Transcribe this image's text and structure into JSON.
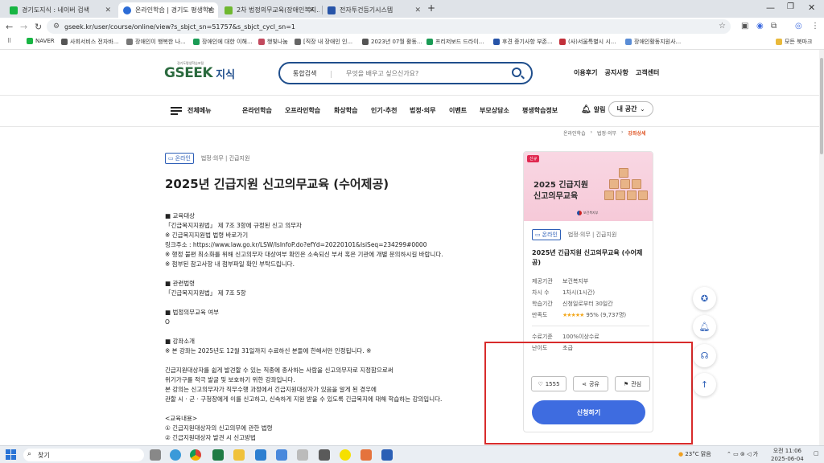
{
  "browser": {
    "tabs": [
      {
        "title": "경기도지식 : 네이버 검색",
        "color": "#18b543"
      },
      {
        "title": "온라인학습 | 경기도 평생학습",
        "color": "#2c6cd6"
      },
      {
        "title": "2차 법정의무교육(장애인복지...",
        "color": "#6fb830"
      },
      {
        "title": "전자투건등기시스템",
        "color": "#2754a8"
      }
    ],
    "new_tab": "+",
    "address": "gseek.kr/user/course/online/view?s_sbjct_sn=51757&s_sbjct_cycl_sn=1",
    "bookmarks": [
      {
        "label": "NAVER",
        "color": "#18b543"
      },
      {
        "label": "사회서비스 전자바...",
        "color": "#555555"
      },
      {
        "label": "장애인이 행복한 나...",
        "color": "#777777"
      },
      {
        "label": "장애인에 대한 이해...",
        "color": "#1a9b55"
      },
      {
        "label": "햇빛나눔",
        "color": "#c24a5e"
      },
      {
        "label": "[직장 내 장애인 인...",
        "color": "#666666"
      },
      {
        "label": "2023년 07월 활동...",
        "color": "#555555"
      },
      {
        "label": "프리저보드 드라이...",
        "color": "#1a9b55"
      },
      {
        "label": "후견 증기사항 부존...",
        "color": "#2754a8"
      },
      {
        "label": "(사)서울특별시 시...",
        "color": "#c2303a"
      },
      {
        "label": "장애인활동지원사...",
        "color": "#5a8dd6"
      }
    ],
    "all_bookmarks": "모든 북마크"
  },
  "header": {
    "logo_small": "경기도평생학습포털",
    "logo_main": "GSEEK",
    "logo_sub": "지식",
    "search_select": "통합검색",
    "search_placeholder": "무엇을 배우고 싶으신가요?",
    "util_links": [
      "이용후기",
      "공지사항",
      "고객센터"
    ],
    "menu_all": "전체메뉴",
    "gnb": [
      "온라인학습",
      "오프라인학습",
      "화상학습",
      "인기·추천",
      "법정·의무",
      "이벤트",
      "부모상담소",
      "평생학습정보"
    ],
    "alarm": "알림",
    "mypage": "내 공간"
  },
  "breadcrumb": [
    "온라인학습",
    "법정·의무",
    "강좌상세"
  ],
  "course": {
    "badge": "온라인",
    "category": "법정·의무  |  긴급지원",
    "title": "2025년 긴급지원 신고의무교육 (수어제공)",
    "description": [
      "■ 교육대상",
      "「긴급복지지원법」 제 7조 3항에 규정된 신고 의무자",
      "※ 긴급복지지원법 법령 바로가기",
      "링크주소 : https://www.law.go.kr/LSW/lsInfoP.do?efYd=20220101&lsiSeq=234299#0000",
      "※ 행정 불편 최소화를 위해 신고의무자 대상여부 확인은 소속되신 부서 혹은 기관에 개별 문의하시길 바랍니다.",
      "※ 첨부된 참고사항 내 첨부파일 확인 부탁드립니다.",
      "",
      "■ 관련법령",
      "「긴급복지지원법」 제 7조 5항",
      "",
      "■ 법정의무교육 여부",
      "O",
      "",
      "■ 강좌소개",
      "※ 본 강좌는 2025년도 12월 31일까지 수료하신 분들에 한해서만 인정됩니다. ※",
      "",
      "긴급지원대상자를 쉽게 발견할 수 있는 직종에 종사하는 사람을 신고의무자로 지정함으로써",
      "위기가구를 적극 발굴 및 보호하기 위한 강좌입니다.",
      "본 강의는 신고의무자가 직무수행 과정에서 긴급지원대상자가 있음을 알게 된 경우에",
      "관할 시 · 군 · 구청장에게 이를 신고하고, 신속하게 지원 받을 수 있도록 긴급복지에 대해 학습하는 강의입니다.",
      "",
      "<교육내용>",
      "① 긴급지원대상자의 신고의무에 관한 법령",
      "② 긴급지원대상자 발견 시 신고방법"
    ]
  },
  "card": {
    "new_tag": "신규",
    "thumb_line1": "2025 긴급지원",
    "thumb_line2": "신고의무교육",
    "thumb_ministry": "보건복지부",
    "badge": "온라인",
    "category": "법정·의무  |  긴급지원",
    "title": "2025년 긴급지원 신고의무교육 (수어제공)",
    "info": [
      {
        "k": "제공기관",
        "v": "보건복지부"
      },
      {
        "k": "차시 수",
        "v": "1차시(1시간)"
      },
      {
        "k": "학습기간",
        "v": "신청일로부터 30일간"
      }
    ],
    "rating_label": "만족도",
    "rating_stars": "★★★★★",
    "rating_value": "95% (9,737명)",
    "rating_fraction": 0.95,
    "complete_label": "수료기준",
    "complete_value": "100%이상수료",
    "level_label": "난이도",
    "level_value": "초급",
    "like_count": "1555",
    "share_label": "공유",
    "interest_label": "관심",
    "apply_label": "신청하기"
  },
  "taskbar": {
    "search": "찾기",
    "weather": "23°C  맑음",
    "time": "오전 11:06",
    "date": "2025-06-04"
  }
}
